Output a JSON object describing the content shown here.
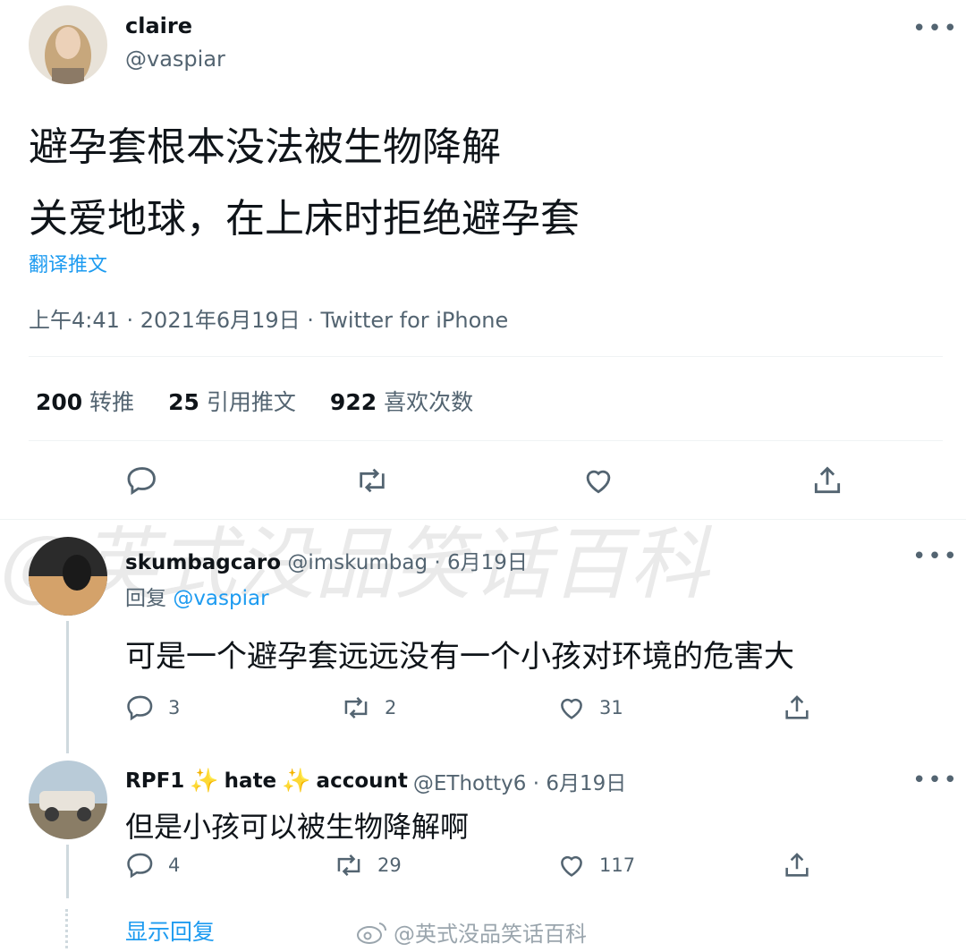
{
  "tweet": {
    "display_name": "claire",
    "handle": "@vaspiar",
    "line1": "避孕套根本没法被生物降解",
    "line2": "关爱地球，在上床时拒绝避孕套",
    "translate": "翻译推文",
    "meta": "上午4:41 · 2021年6月19日 · Twitter for iPhone",
    "stats": [
      {
        "value": "200",
        "label": "转推"
      },
      {
        "value": "25",
        "label": "引用推文"
      },
      {
        "value": "922",
        "label": "喜欢次数"
      }
    ]
  },
  "replies": [
    {
      "display_name": "skumbagcaro",
      "handle_date": "@imskumbag · 6月19日",
      "reply_prefix": "回复",
      "reply_to": "@vaspiar",
      "text": "可是一个避孕套远远没有一个小孩对环境的危害大",
      "counts": {
        "reply": "3",
        "retweet": "2",
        "like": "31"
      }
    },
    {
      "name_a": "RPF1",
      "name_b": "hate",
      "name_c": "account",
      "handle_date": "@EThotty6 · 6月19日",
      "text": "但是小孩可以被生物降解啊",
      "counts": {
        "reply": "4",
        "retweet": "29",
        "like": "117"
      }
    }
  ],
  "show_replies": "显示回复",
  "watermark": {
    "main": "@英式没品笑话百科",
    "bottom": "@英式没品笑话百科"
  }
}
